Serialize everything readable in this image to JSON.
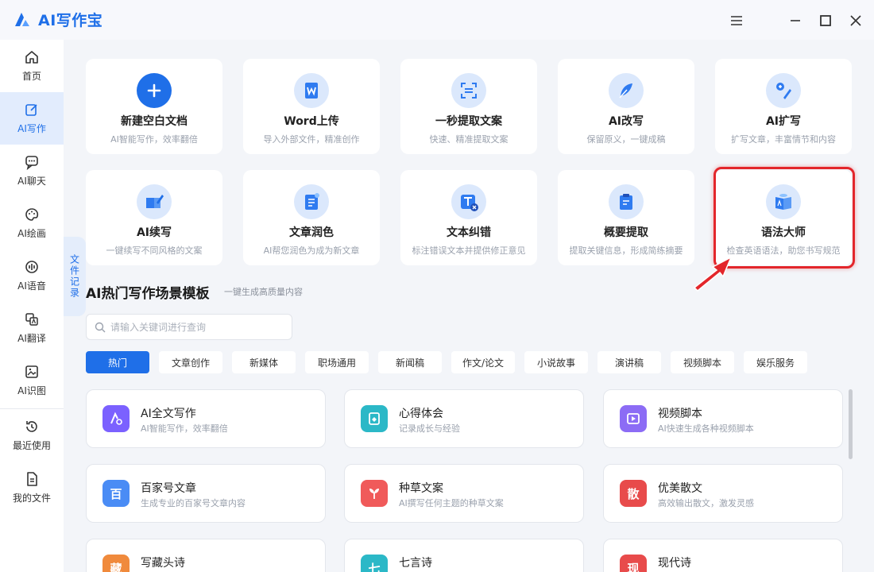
{
  "app": {
    "title": "AI写作宝"
  },
  "sidebar": {
    "items": [
      {
        "label": "首页"
      },
      {
        "label": "AI写作"
      },
      {
        "label": "AI聊天"
      },
      {
        "label": "AI绘画"
      },
      {
        "label": "AI语音"
      },
      {
        "label": "AI翻译"
      },
      {
        "label": "AI识图"
      },
      {
        "label": "最近使用"
      },
      {
        "label": "我的文件"
      }
    ],
    "active": "AI写作"
  },
  "file_record": {
    "label": "文件记录"
  },
  "tools": [
    {
      "title": "新建空白文档",
      "desc": "AI智能写作，效率翻倍",
      "icon": "plus-icon"
    },
    {
      "title": "Word上传",
      "desc": "导入外部文件，精准创作",
      "icon": "word-icon"
    },
    {
      "title": "一秒提取文案",
      "desc": "快速、精准提取文案",
      "icon": "scan-icon"
    },
    {
      "title": "AI改写",
      "desc": "保留原义，一键成稿",
      "icon": "feather-icon"
    },
    {
      "title": "AI扩写",
      "desc": "扩写文章，丰富情节和内容",
      "icon": "expand-icon"
    },
    {
      "title": "AI续写",
      "desc": "一键续写不同风格的文案",
      "icon": "pen-book-icon"
    },
    {
      "title": "文章润色",
      "desc": "AI帮您润色为成为新文章",
      "icon": "polish-icon"
    },
    {
      "title": "文本纠错",
      "desc": "标注错误文本并提供修正意见",
      "icon": "text-correct-icon"
    },
    {
      "title": "概要提取",
      "desc": "提取关键信息，形成简练摘要",
      "icon": "clipboard-icon"
    },
    {
      "title": "语法大师",
      "desc": "检查英语语法，助您书写规范",
      "icon": "grammar-book-icon"
    }
  ],
  "templates_section": {
    "title": "AI热门写作场景模板",
    "subtitle": "一键生成高质量内容",
    "search_placeholder": "请输入关键词进行查询",
    "tabs": [
      "热门",
      "文章创作",
      "新媒体",
      "职场通用",
      "新闻稿",
      "作文/论文",
      "小说故事",
      "演讲稿",
      "视频脚本",
      "娱乐服务"
    ],
    "active_tab": "热门",
    "cards": [
      {
        "title": "AI全文写作",
        "desc": "AI智能写作，效率翻倍",
        "icon": "ai-writing-icon",
        "color": "#7b61ff",
        "glyph": ""
      },
      {
        "title": "心得体会",
        "desc": "记录成长与经验",
        "icon": "portrait-icon",
        "color": "#2bb8c7",
        "glyph": ""
      },
      {
        "title": "视频脚本",
        "desc": "AI快速生成各种视频脚本",
        "icon": "video-icon",
        "color": "#8c6cf5",
        "glyph": ""
      },
      {
        "title": "百家号文章",
        "desc": "生成专业的百家号文章内容",
        "icon": "baijia-icon",
        "color": "#4a8cf5",
        "glyph": "百"
      },
      {
        "title": "种草文案",
        "desc": "AI撰写任何主题的种草文案",
        "icon": "sprout-icon",
        "color": "#f05a5a",
        "glyph": ""
      },
      {
        "title": "优美散文",
        "desc": "高效输出散文，激发灵感",
        "icon": "prose-icon",
        "color": "#e84b4b",
        "glyph": "散"
      },
      {
        "title": "写藏头诗",
        "desc": "",
        "icon": "acrostic-icon",
        "color": "#f08a3c",
        "glyph": "藏"
      },
      {
        "title": "七言诗",
        "desc": "",
        "icon": "seven-char-icon",
        "color": "#2bb8c7",
        "glyph": "七"
      },
      {
        "title": "现代诗",
        "desc": "",
        "icon": "modern-poem-icon",
        "color": "#e84b4b",
        "glyph": "现"
      }
    ]
  },
  "colors": {
    "accent": "#1f6fe8",
    "highlight": "#e3262b"
  }
}
